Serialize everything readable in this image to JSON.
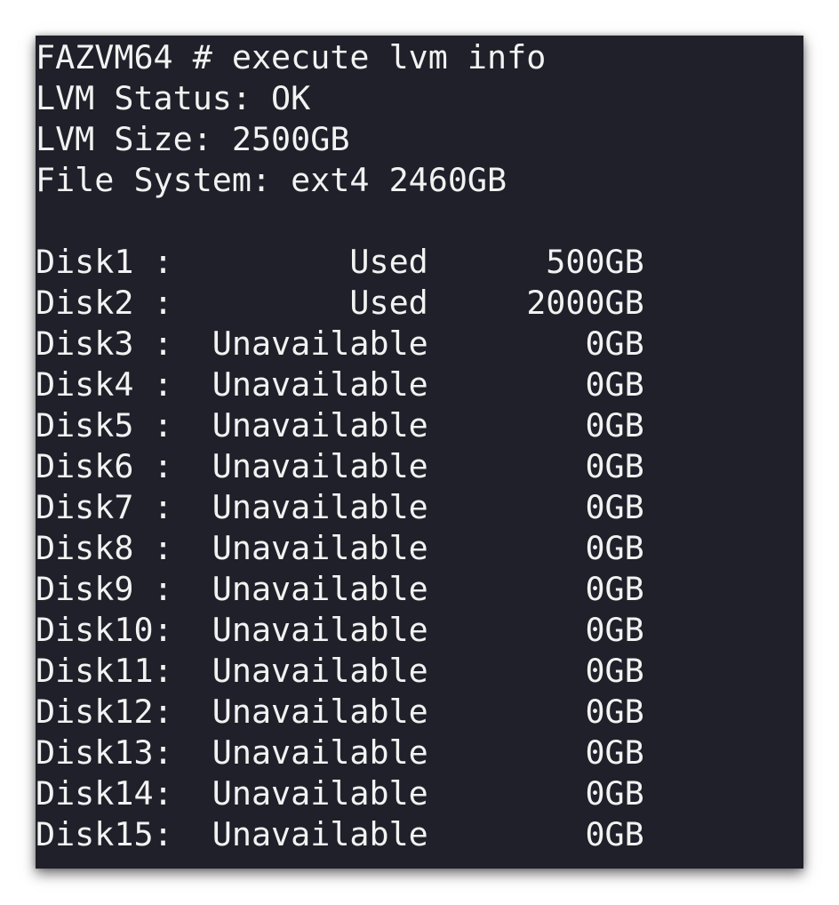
{
  "terminal": {
    "prompt_line": "FAZVM64 # execute lvm info",
    "status_line": "LVM Status: OK",
    "size_line": "LVM Size: 2500GB",
    "fs_line": "File System: ext4 2460GB",
    "disks": [
      "Disk1 :         Used      500GB",
      "Disk2 :         Used     2000GB",
      "Disk3 :  Unavailable        0GB",
      "Disk4 :  Unavailable        0GB",
      "Disk5 :  Unavailable        0GB",
      "Disk6 :  Unavailable        0GB",
      "Disk7 :  Unavailable        0GB",
      "Disk8 :  Unavailable        0GB",
      "Disk9 :  Unavailable        0GB",
      "Disk10:  Unavailable        0GB",
      "Disk11:  Unavailable        0GB",
      "Disk12:  Unavailable        0GB",
      "Disk13:  Unavailable        0GB",
      "Disk14:  Unavailable        0GB",
      "Disk15:  Unavailable        0GB"
    ]
  },
  "colors": {
    "background": "#20202a",
    "text": "#f2f2f2"
  }
}
